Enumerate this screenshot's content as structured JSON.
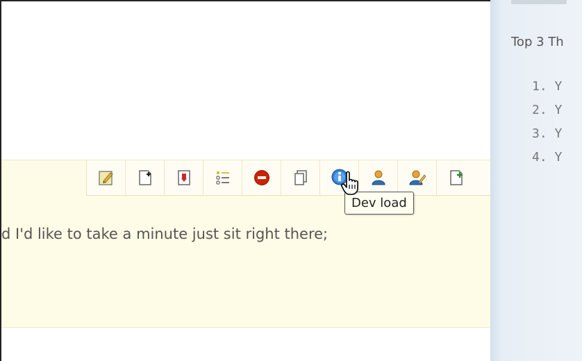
{
  "note": {
    "text": "d I'd like to take a minute just sit right there;"
  },
  "toolbar": {
    "buttons": [
      {
        "icon": "edit-icon"
      },
      {
        "icon": "add-page-icon"
      },
      {
        "icon": "export-icon"
      },
      {
        "icon": "checklist-icon"
      },
      {
        "icon": "delete-icon"
      },
      {
        "icon": "copy-icon"
      },
      {
        "icon": "info-icon"
      },
      {
        "icon": "user-icon"
      },
      {
        "icon": "edit-user-icon"
      },
      {
        "icon": "add-page-icon"
      }
    ],
    "tooltip": "Dev load"
  },
  "sidebar": {
    "intro": "Top 3 Th",
    "items": [
      "1. Y",
      "2. Y",
      "3. Y",
      "4. Y"
    ]
  },
  "colors": {
    "note_bg": "#fefbe6",
    "sidebar_bg": "#e7eef5",
    "delete_red": "#cc2200",
    "info_blue": "#2f7fd6"
  }
}
